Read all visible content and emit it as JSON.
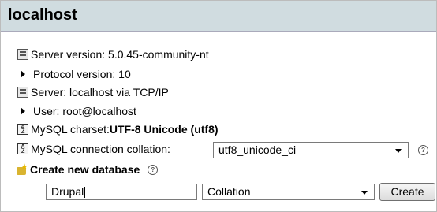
{
  "header": {
    "title": "localhost"
  },
  "info": {
    "server_version": "Server version: 5.0.45-community-nt",
    "protocol_version": "Protocol version: 10",
    "server": "Server: localhost via TCP/IP",
    "user": "User: root@localhost",
    "charset_label": "MySQL charset: ",
    "charset_value": "UTF-8 Unicode (utf8)"
  },
  "collation": {
    "label": "MySQL connection collation:",
    "selected": "utf8_unicode_ci"
  },
  "create_db": {
    "label": "Create new database",
    "name_value": "Drupal",
    "collation_placeholder": "Collation",
    "button_label": "Create"
  }
}
